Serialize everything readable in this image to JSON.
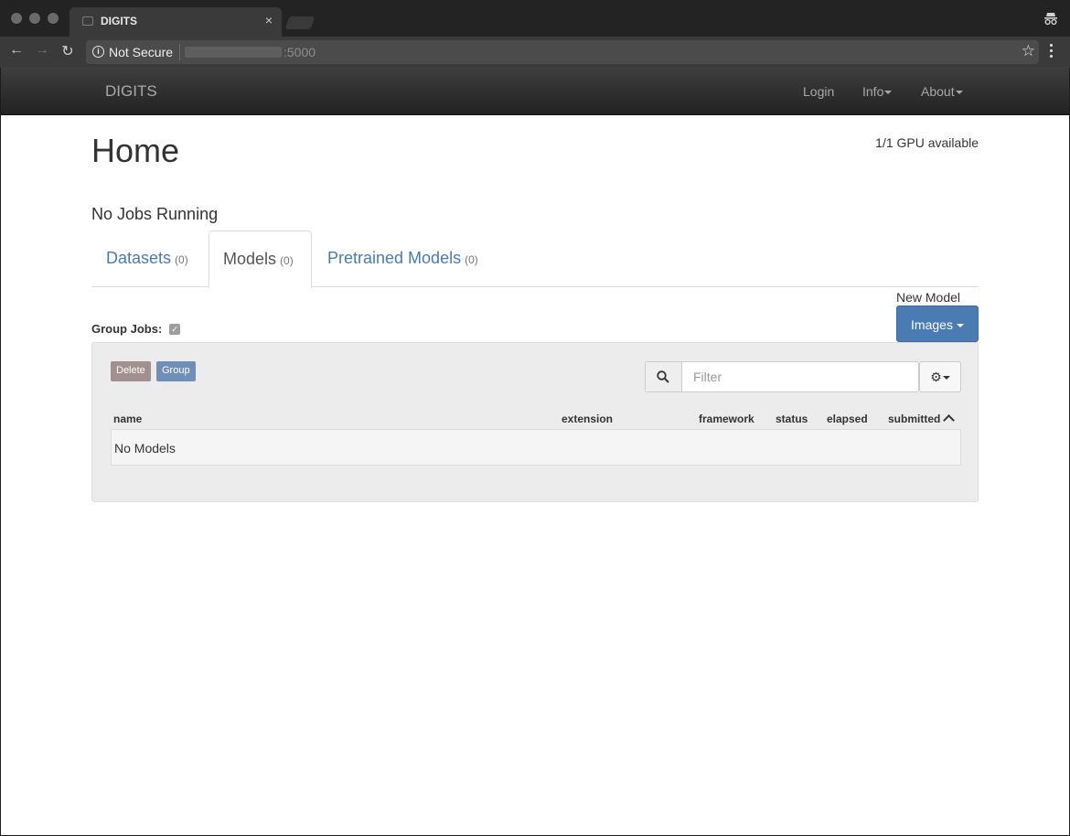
{
  "browser": {
    "tab_title": "DIGITS",
    "tab_close": "×",
    "security_label": "Not Secure",
    "url_port": ":5000",
    "icons": {
      "back": "←",
      "forward": "→",
      "reload": "↻",
      "bookmark": "☆"
    }
  },
  "navbar": {
    "brand": "DIGITS",
    "links": [
      {
        "label": "Login",
        "has_caret": false
      },
      {
        "label": "Info",
        "has_caret": true
      },
      {
        "label": "About",
        "has_caret": true
      }
    ]
  },
  "page": {
    "title": "Home",
    "gpu_status": "1/1 GPU available",
    "jobs_status": "No Jobs Running",
    "tabs": [
      {
        "label": "Datasets",
        "count": "(0)",
        "active": false
      },
      {
        "label": "Models",
        "count": "(0)",
        "active": true
      },
      {
        "label": "Pretrained Models",
        "count": "(0)",
        "active": false
      }
    ],
    "new_model_label": "New Model",
    "new_model_button": "Images",
    "group_jobs_label": "Group Jobs:",
    "group_jobs_checked": true,
    "toolbar": {
      "delete_label": "Delete",
      "group_label": "Group",
      "filter_placeholder": "Filter"
    },
    "table": {
      "columns": [
        "name",
        "extension",
        "framework",
        "status",
        "elapsed",
        "submitted"
      ],
      "sorted_column": "submitted",
      "empty_message": "No Models"
    }
  },
  "colors": {
    "primary": "#4b7bb3",
    "link": "#4a7ab2",
    "navbar": "#2c2c2c",
    "delete": "#a28f8f",
    "group": "#6e8fba"
  }
}
